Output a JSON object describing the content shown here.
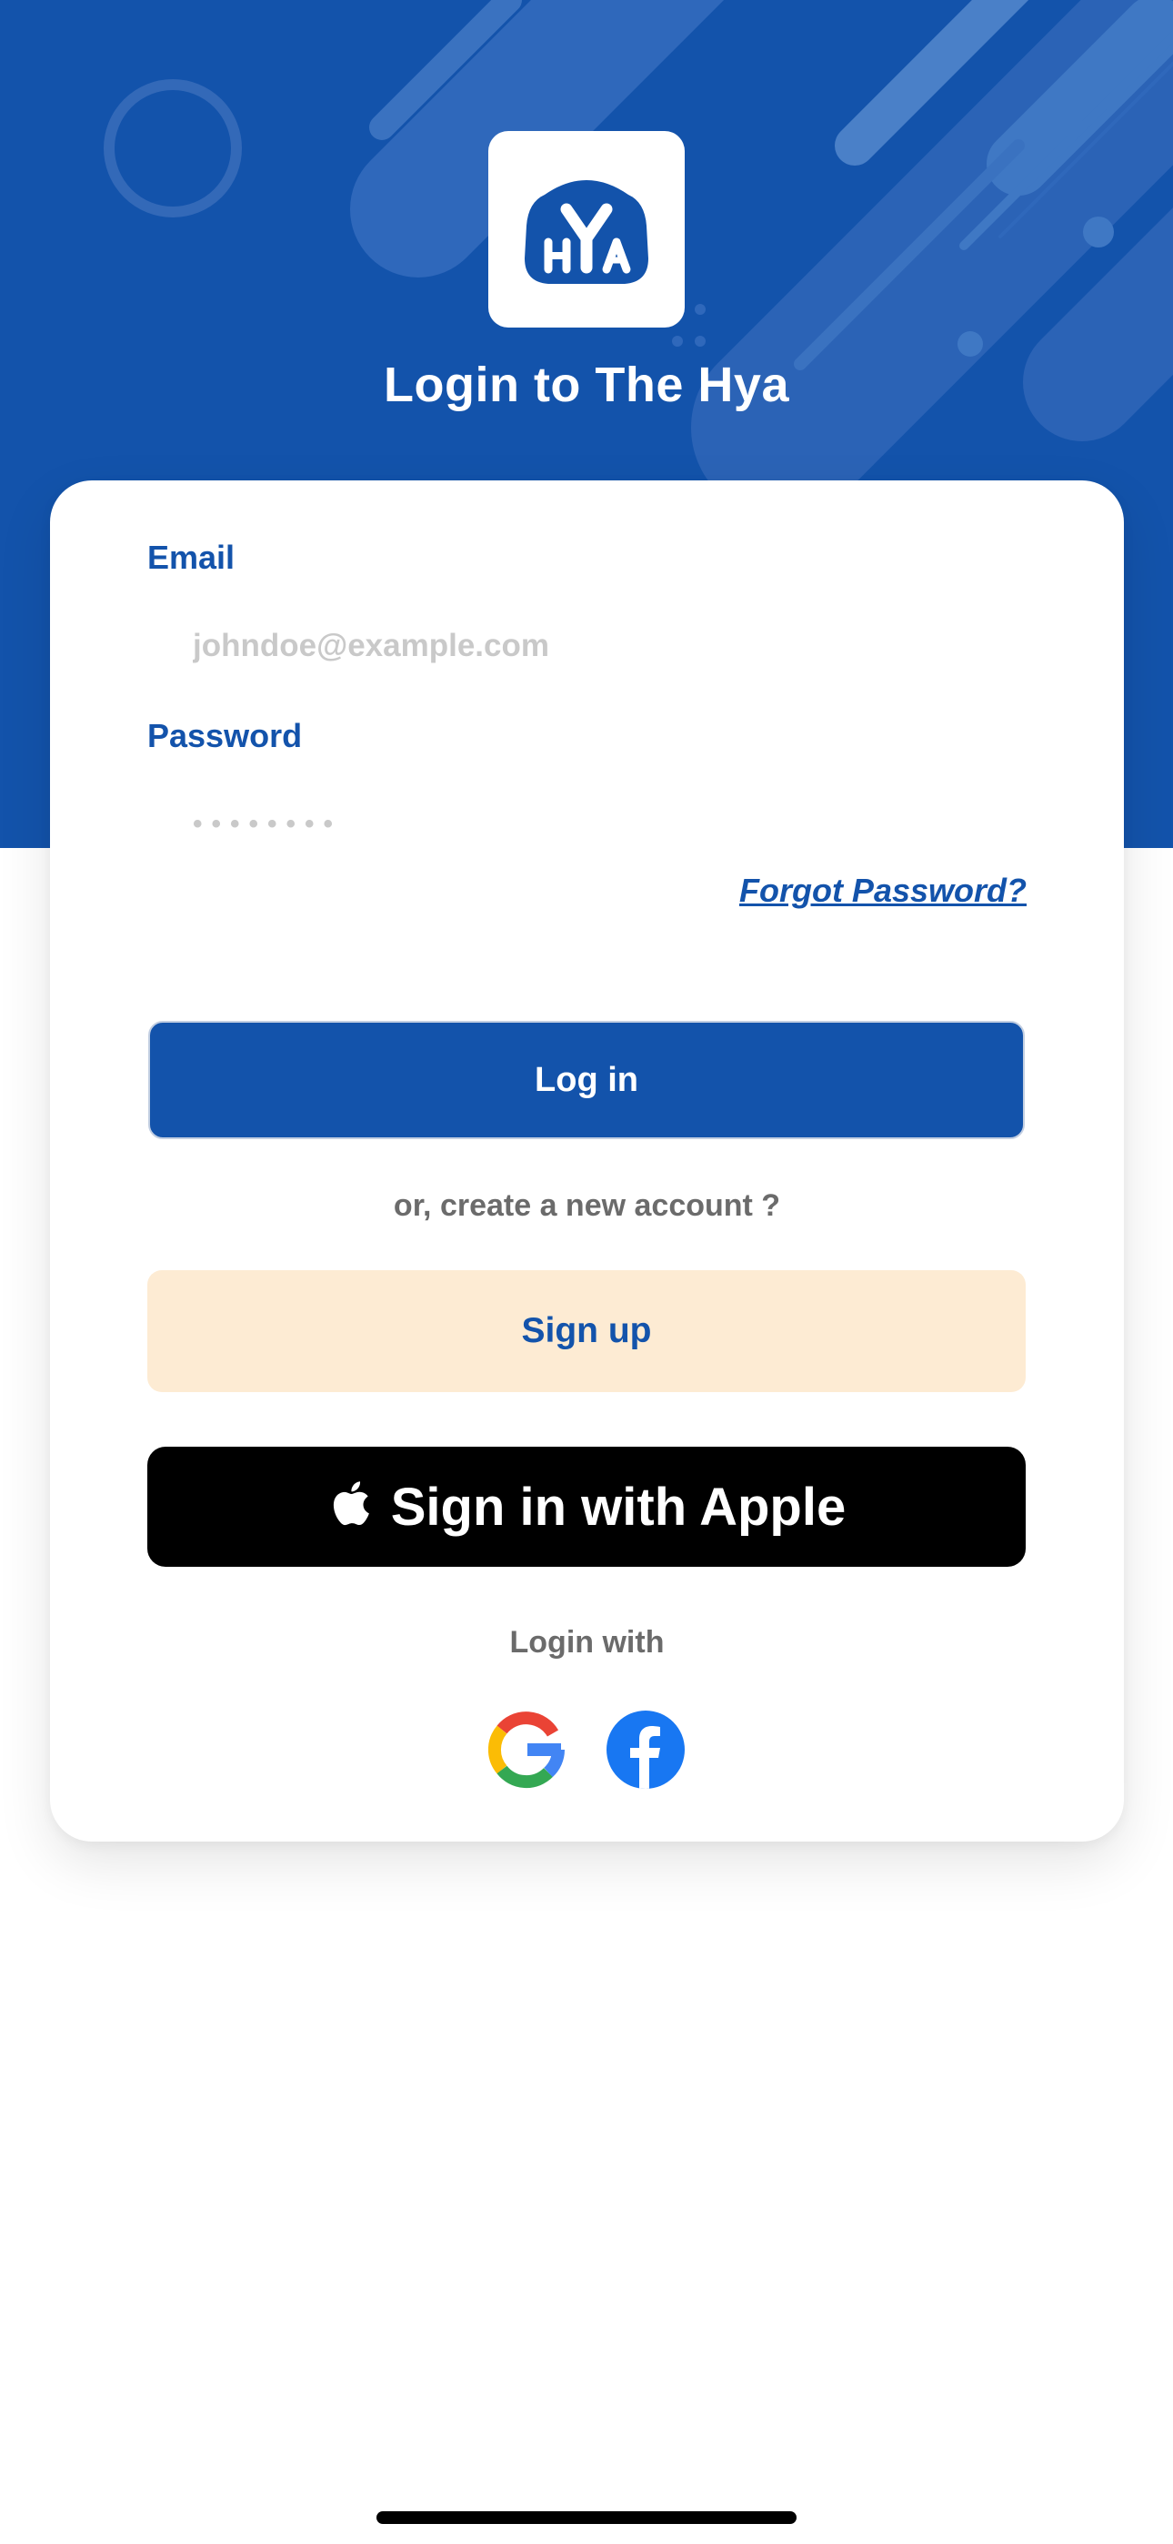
{
  "header": {
    "title": "Login to The Hya",
    "logo_text": "HYA",
    "background_color": "#1353ab"
  },
  "form": {
    "email_label": "Email",
    "email_placeholder": "johndoe@example.com",
    "password_label": "Password",
    "password_placeholder": "••••••••",
    "forgot_password": "Forgot Password?"
  },
  "actions": {
    "login_label": "Log in",
    "create_account_prompt": "or, create a new account ?",
    "signup_label": "Sign up",
    "apple_label": "Sign in with Apple"
  },
  "social": {
    "heading": "Login with",
    "providers": [
      {
        "name": "google-icon"
      },
      {
        "name": "facebook-icon"
      }
    ]
  },
  "colors": {
    "primary": "#1353ab",
    "signup_bg": "#fdebd3",
    "apple_bg": "#000000",
    "muted_text": "#6b6b6b",
    "facebook": "#1877f2"
  }
}
